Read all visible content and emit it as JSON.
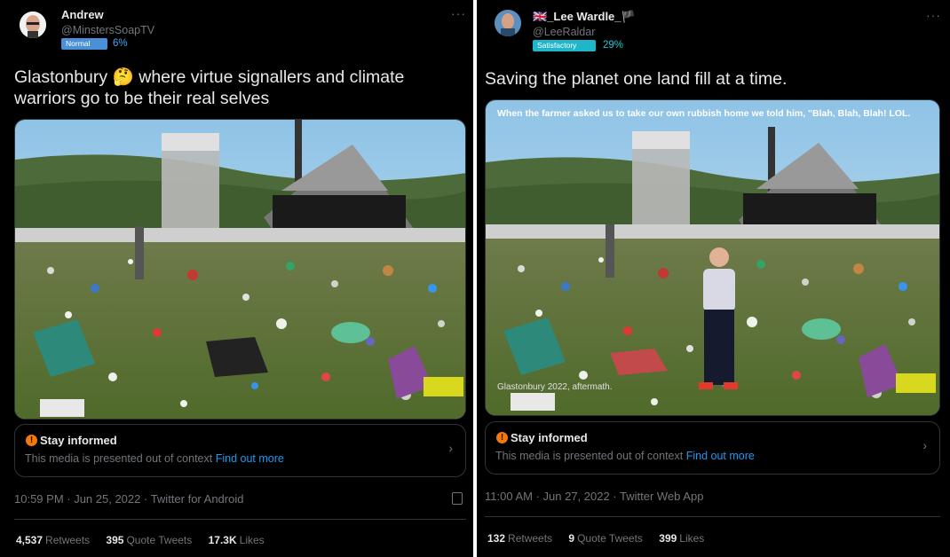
{
  "tweets": [
    {
      "author_name": "Andrew",
      "author_handle": "@MinstersSoapTV",
      "badge_label": "Normal",
      "badge_pct": "6%",
      "text": "Glastonbury 🤔 where virtue signallers and climate warriors go to be their real selves",
      "notice_title": "Stay informed",
      "notice_text": "This media is presented out of context",
      "notice_link": "Find out more",
      "timestamp": "10:59 PM · Jun 25, 2022 · Twitter for Android",
      "retweets": "4,537",
      "retweets_label": "Retweets",
      "quotes": "395",
      "quotes_label": "Quote Tweets",
      "likes": "17.3K",
      "likes_label": "Likes"
    },
    {
      "author_name": "🇬🇧_Lee Wardle_🏴",
      "author_handle": "@LeeRaldar",
      "badge_label": "Satisfactory",
      "badge_pct": "29%",
      "text": "Saving the planet one land fill at a time.",
      "image_caption_top": "When the farmer asked us to take our own rubbish home we told him, \"Blah, Blah, Blah! LOL.",
      "image_caption_bottom": "Glastonbury 2022, aftermath.",
      "notice_title": "Stay informed",
      "notice_text": "This media is presented out of context",
      "notice_link": "Find out more",
      "timestamp": "11:00 AM · Jun 27, 2022 · Twitter Web App",
      "retweets": "132",
      "retweets_label": "Retweets",
      "quotes": "9",
      "quotes_label": "Quote Tweets",
      "likes": "399",
      "likes_label": "Likes"
    }
  ],
  "colors": {
    "normal_badge": "#1d9bf0",
    "satisfactory_badge": "#1fb6c9",
    "link": "#1d9bf0",
    "warning": "#f4780b"
  },
  "icons": [
    "more-icon",
    "warning-icon",
    "chevron-right-icon",
    "card-icon"
  ]
}
